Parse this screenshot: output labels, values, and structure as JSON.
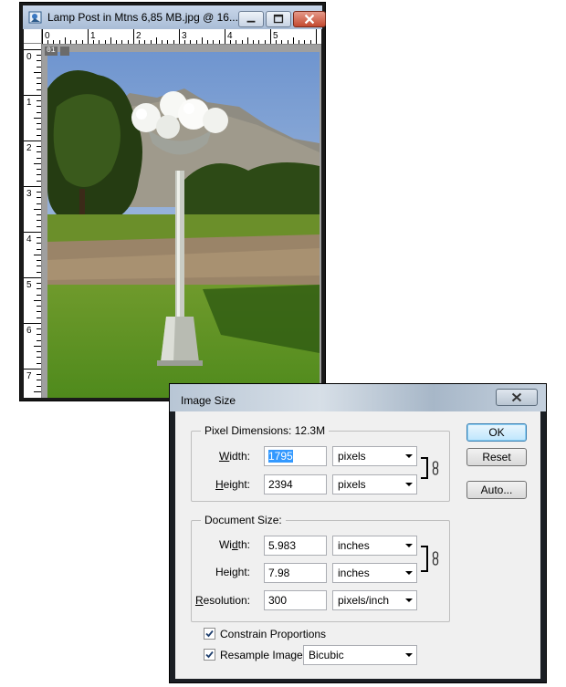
{
  "doc_window": {
    "title": "Lamp Post in Mtns 6,85 MB.jpg @ 16...",
    "ruler_top_labels": [
      "0",
      "1",
      "2",
      "3",
      "4",
      "5"
    ],
    "ruler_left_labels": [
      "0",
      "1",
      "2",
      "3",
      "4",
      "5",
      "6",
      "7"
    ],
    "slice_badge": "01"
  },
  "dialog": {
    "title": "Image Size",
    "pixel_dimensions": {
      "legend": "Pixel Dimensions:",
      "total": "12.3M",
      "width_label": "Width:",
      "width_value": "1795",
      "width_unit": "pixels",
      "height_label": "Height:",
      "height_value": "2394",
      "height_unit": "pixels"
    },
    "document_size": {
      "legend": "Document Size:",
      "width_label": "Width:",
      "width_value": "5.983",
      "width_unit": "inches",
      "height_label": "Height:",
      "height_value": "7.98",
      "height_unit": "inches",
      "resolution_label": "Resolution:",
      "resolution_value": "300",
      "resolution_unit": "pixels/inch"
    },
    "buttons": {
      "ok": "OK",
      "reset": "Reset",
      "auto": "Auto..."
    },
    "constrain_proportions": {
      "label": "Constrain Proportions",
      "checked": true
    },
    "resample_image": {
      "label": "Resample Image:",
      "checked": true,
      "method": "Bicubic"
    }
  }
}
